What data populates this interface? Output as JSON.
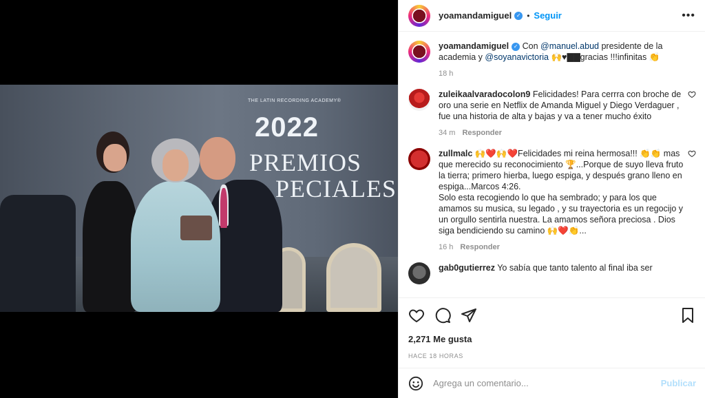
{
  "post": {
    "username": "yoamandamiguel",
    "follow_label": "Seguir",
    "separator": "•",
    "more_label": "•••",
    "image_text": {
      "academy": "THE LATIN RECORDING ACADEMY®",
      "year": "2022",
      "line1": "PREMIOS",
      "line2": "PECIALES"
    }
  },
  "caption": {
    "username": "yoamandamiguel",
    "text_1": " Con ",
    "mention_1": "@manuel.abud",
    "text_2": " presidente de la academia y ",
    "mention_2": "@soyanavictoria",
    "text_3": " 🙌♥▇▇gracias !!!infinitas 👏",
    "time": "18 h"
  },
  "comments": [
    {
      "username": "zuleikaalvaradocolon9",
      "text": " Felicidades! Para cerrra con broche de oro una serie en Netflix de Amanda Miguel y Diego Verdaguer , fue una historia de alta y bajas y va a tener mucho éxito",
      "time": "34 m",
      "reply": "Responder"
    },
    {
      "username": "zullmalc",
      "text": " 🙌❤️🙌❤️Felicidades mi reina hermosa!!! 👏👏 mas que merecido su reconocimiento 🏆...Porque de suyo lleva fruto la tierra; primero hierba, luego espiga, y después grano lleno en espiga...Marcos 4:26.",
      "text_b": "Solo esta recogiendo lo que ha sembrado; y para los que amamos su musica, su legado , y su trayectoria es un regocijo y un orgullo sentirla nuestra. La amamos señora preciosa . Dios siga bendiciendo su camino 🙌❤️👏...",
      "time": "16 h",
      "reply": "Responder"
    },
    {
      "username": "gab0gutierrez",
      "text": " Yo sabía que tanto talento al final iba ser"
    }
  ],
  "actions": {
    "likes": "2,271 Me gusta",
    "posted": "HACE 18 HORAS"
  },
  "composer": {
    "placeholder": "Agrega un comentario...",
    "post_label": "Publicar"
  }
}
